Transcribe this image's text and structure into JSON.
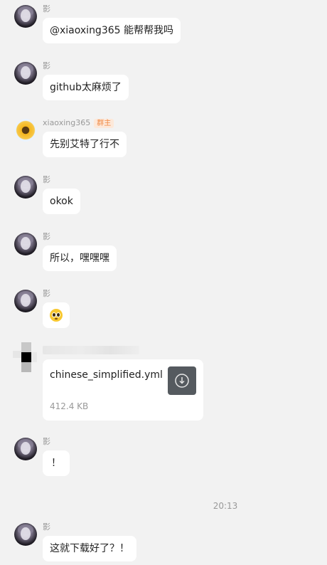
{
  "messages": [
    {
      "sender": "影",
      "text": "@xiaoxing365 能帮帮我吗"
    },
    {
      "sender": "影",
      "text": "github太麻烦了"
    },
    {
      "sender": "xiaoxing365",
      "badge": "群主",
      "text": "先别艾特了行不"
    },
    {
      "sender": "影",
      "text": "okok"
    },
    {
      "sender": "影",
      "text": "所以，嘿嘿嘿"
    },
    {
      "sender": "影",
      "emoji": "pleading-face-emoji"
    },
    {
      "sender_hidden": true,
      "file": {
        "name": "chinese_simplified.yml",
        "size": "412.4 KB",
        "icon": "download-icon"
      }
    },
    {
      "sender": "影",
      "text": "！"
    },
    {
      "sender": "影",
      "text": "这就下载好了？！"
    }
  ],
  "divider": {
    "time": "20:13"
  },
  "colors": {
    "background": "#f2f2f2",
    "bubble": "#ffffff",
    "badge_text": "#f08a46",
    "badge_bg": "#fde8d9",
    "download_bg": "#555a5f"
  }
}
